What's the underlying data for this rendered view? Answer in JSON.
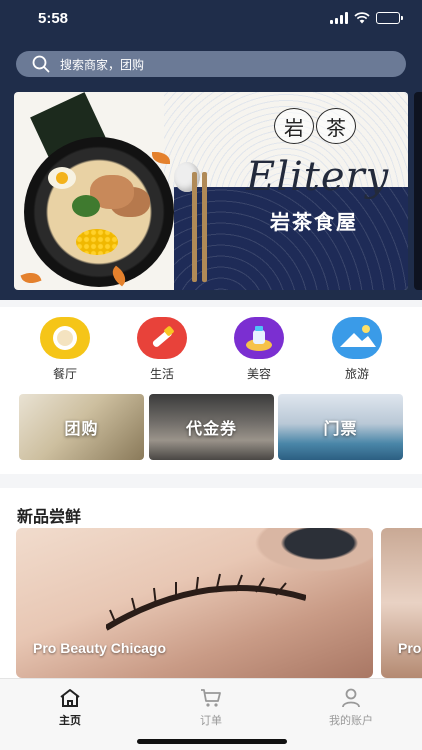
{
  "status_bar": {
    "time": "5:58",
    "battery_color": "#4cd964"
  },
  "search": {
    "placeholder": "搜索商家，团购"
  },
  "banner": {
    "seal_left": "岩",
    "seal_right": "茶",
    "brand_en": "Elitery",
    "brand_cn": "岩茶食屋"
  },
  "categories": [
    {
      "label": "餐厅",
      "icon": "restaurant-icon",
      "color": "#f5c518"
    },
    {
      "label": "生活",
      "icon": "life-icon",
      "color": "#e8423a"
    },
    {
      "label": "美容",
      "icon": "beauty-icon",
      "color": "#7b2fd1"
    },
    {
      "label": "旅游",
      "icon": "travel-icon",
      "color": "#3a9be8"
    }
  ],
  "deals": [
    {
      "label": "团购"
    },
    {
      "label": "代金券"
    },
    {
      "label": "门票"
    }
  ],
  "new_section": {
    "title": "新品尝鲜",
    "cards": [
      {
        "caption": "Pro Beauty Chicago"
      },
      {
        "caption": "Pro"
      }
    ]
  },
  "tabbar": {
    "items": [
      {
        "label": "主页",
        "icon": "home-icon",
        "active": true
      },
      {
        "label": "订单",
        "icon": "cart-icon",
        "active": false
      },
      {
        "label": "我的账户",
        "icon": "user-icon",
        "active": false
      }
    ]
  }
}
